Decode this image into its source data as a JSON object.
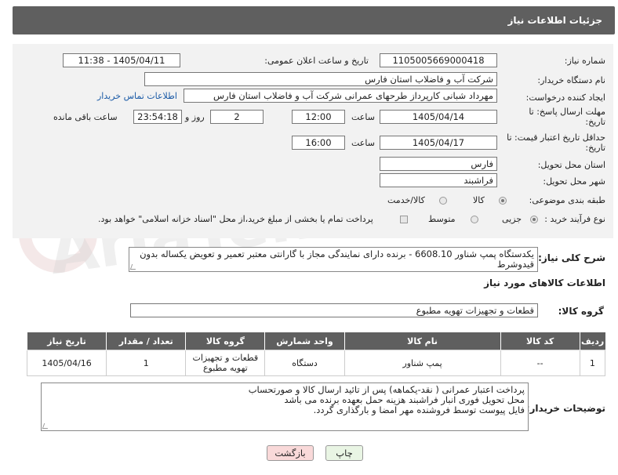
{
  "header": {
    "title": "جزئیات اطلاعات نیاز"
  },
  "fields": {
    "need_number_label": "شماره نیاز:",
    "need_number": "1105005669000418",
    "announce_label": "تاریخ و ساعت اعلان عمومی:",
    "announce_value": "1405/04/11 - 11:38",
    "buyer_org_label": "نام دستگاه خریدار:",
    "buyer_org": "شرکت آب و فاضلاب استان فارس",
    "creator_label": "ایجاد کننده درخواست:",
    "creator": "مهرداد شبانی کارپرداز طرحهای عمرانی  شرکت آب و فاضلاب استان فارس",
    "contact_link": "اطلاعات تماس خریدار",
    "reply_deadline_label": "مهلت ارسال پاسخ: تا تاریخ:",
    "reply_date": "1405/04/14",
    "time_label": "ساعت",
    "reply_time": "12:00",
    "days_value": "2",
    "days_label": "روز و",
    "remaining_time": "23:54:18",
    "remaining_label": "ساعت باقی مانده",
    "price_validity_label": "حداقل تاریخ اعتبار قیمت: تا تاریخ:",
    "price_date": "1405/04/17",
    "price_time": "16:00",
    "province_label": "استان محل تحویل:",
    "province": "فارس",
    "city_label": "شهر محل تحویل:",
    "city": "فراشبند",
    "category_label": "طبقه بندی موضوعی:",
    "category_opt1": "کالا",
    "category_opt2": "کالا/خدمت",
    "purchase_type_label": "نوع فرآیند خرید :",
    "purchase_opt1": "جزیی",
    "purchase_opt2": "متوسط",
    "payment_note": "پرداخت تمام یا بخشی از مبلغ خرید،از محل \"اسناد خزانه اسلامی\" خواهد بود."
  },
  "summary": {
    "label": "شرح کلی نیاز:",
    "text": "یکدستگاه پمپ شناور 6608.10 - برنده دارای نمایندگی مجاز با گارانتی معتبر تعمیر و تعویض یکساله بدون قیدوشرط"
  },
  "goods_info_title": "اطلاعات کالاهای مورد نیاز",
  "goods_group": {
    "label": "گروه کالا:",
    "value": "قطعات و تجهیزات تهویه مطبوع"
  },
  "table": {
    "headers": [
      "ردیف",
      "کد کالا",
      "نام کالا",
      "واحد شمارش",
      "گروه کالا",
      "تعداد / مقدار",
      "تاریخ نیاز"
    ],
    "rows": [
      [
        "1",
        "--",
        "پمپ شناور",
        "دستگاه",
        "قطعات و تجهیزات تهویه مطبوع",
        "1",
        "1405/04/16"
      ]
    ]
  },
  "buyer_notes": {
    "label": "توضیحات خریدار:",
    "lines": [
      "پرداخت اعتبار عمرانی ( نقد-یکماهه) پس از تائید ارسال کالا و صورتحساب",
      "محل تحویل فوری انبار فراشبند هزینه حمل بعهده برنده می باشد",
      "فایل پیوست توسط فروشنده مهر امضا و بارگذاری گردد."
    ]
  },
  "buttons": {
    "print": "چاپ",
    "back": "بازگشت"
  },
  "colors": {
    "header_bg": "#5f5f5f",
    "panel_bg": "#f2f2f2",
    "link": "#1a5aa6",
    "back_btn_bg": "#f9d9d9",
    "print_btn_bg": "#e9f5e4"
  }
}
